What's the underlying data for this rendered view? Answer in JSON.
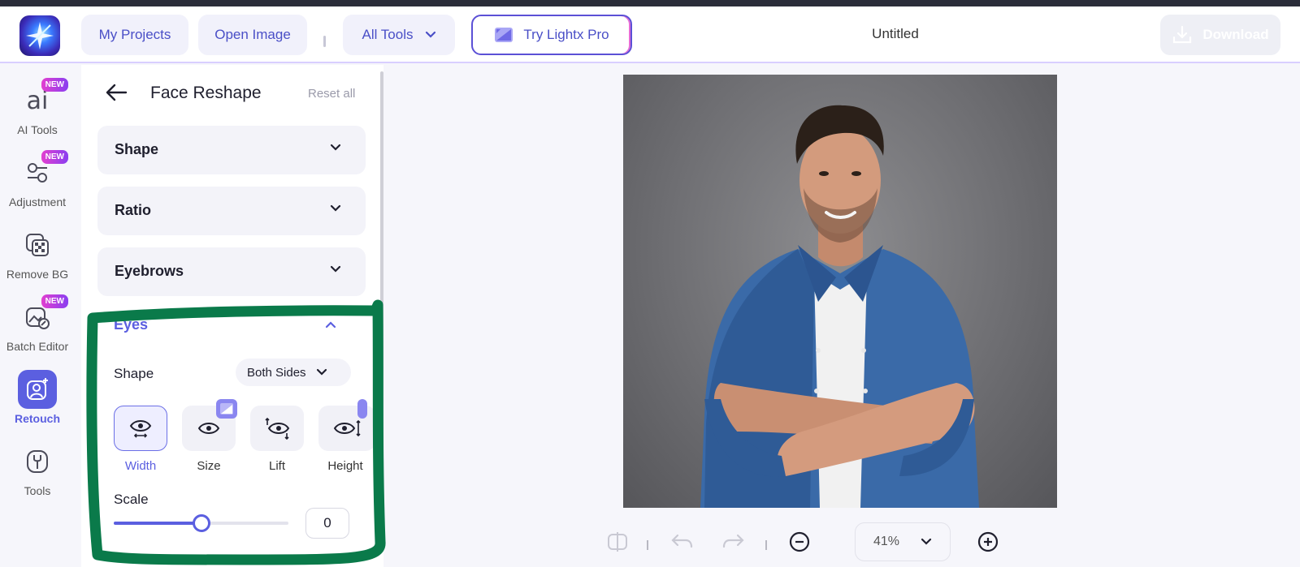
{
  "header": {
    "my_projects": "My Projects",
    "open_image": "Open Image",
    "all_tools": "All Tools",
    "try_pro": "Try Lightx Pro",
    "document_title": "Untitled",
    "download": "Download"
  },
  "rail": {
    "items": [
      {
        "label": "AI Tools",
        "badge": "NEW",
        "icon": "ai-icon"
      },
      {
        "label": "Adjustment",
        "badge": "NEW",
        "icon": "adjustment-icon"
      },
      {
        "label": "Remove BG",
        "badge": "",
        "icon": "remove-bg-icon"
      },
      {
        "label": "Batch Editor",
        "badge": "NEW",
        "icon": "batch-editor-icon"
      },
      {
        "label": "Retouch",
        "badge": "",
        "icon": "retouch-icon",
        "active": true
      },
      {
        "label": "Tools",
        "badge": "",
        "icon": "tools-icon"
      }
    ],
    "ai_glyph": "ai"
  },
  "panel": {
    "title": "Face Reshape",
    "reset": "Reset all",
    "sections": [
      "Shape",
      "Ratio",
      "Eyebrows"
    ],
    "eyes": {
      "title": "Eyes",
      "shape_label": "Shape",
      "side_select": "Both Sides",
      "tools": [
        "Width",
        "Size",
        "Lift",
        "Height"
      ],
      "selected_tool": "Width",
      "scale_label": "Scale",
      "scale_value": "0",
      "slider_fraction": 0.5
    }
  },
  "canvas": {
    "zoom": "41%"
  },
  "colors": {
    "accent": "#5b5fe0",
    "highlight": "#0a7a4a"
  }
}
